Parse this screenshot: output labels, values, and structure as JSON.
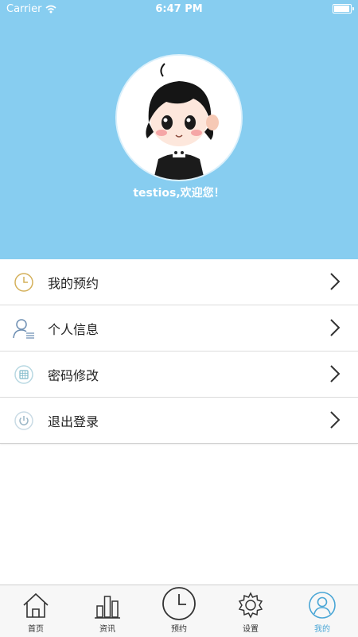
{
  "status_bar": {
    "carrier": "Carrier",
    "time": "6:47 PM"
  },
  "profile": {
    "welcome": "testios,欢迎您！"
  },
  "menu": [
    {
      "label": "我的预约",
      "icon": "clock-icon",
      "icon_color": "#d4b05a"
    },
    {
      "label": "个人信息",
      "icon": "person-icon",
      "icon_color": "#6e8fb3"
    },
    {
      "label": "密码修改",
      "icon": "keypad-icon",
      "icon_color": "#7fb9c9"
    },
    {
      "label": "退出登录",
      "icon": "power-icon",
      "icon_color": "#9ab6c6"
    }
  ],
  "tabs": [
    {
      "label": "首页",
      "icon": "home-icon"
    },
    {
      "label": "资讯",
      "icon": "news-chart-icon"
    },
    {
      "label": "预约",
      "icon": "clock-icon"
    },
    {
      "label": "设置",
      "icon": "gear-icon"
    },
    {
      "label": "我的",
      "icon": "person-icon",
      "active": true
    }
  ],
  "colors": {
    "header": "#87cdf0",
    "active_tab": "#4aa6d6"
  }
}
